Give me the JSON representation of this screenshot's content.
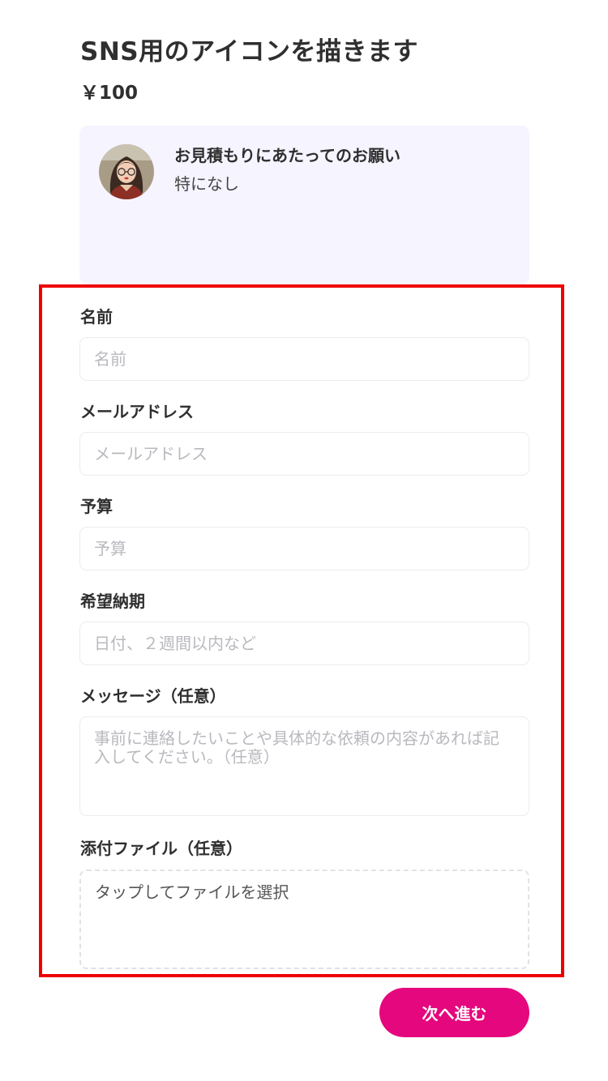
{
  "header": {
    "title": "SNS用のアイコンを描きます",
    "price": "￥100"
  },
  "request": {
    "title": "お見積もりにあたってのお願い",
    "body": "特になし",
    "avatar_icon": "seller-avatar"
  },
  "form": {
    "name": {
      "label": "名前",
      "placeholder": "名前",
      "value": ""
    },
    "email": {
      "label": "メールアドレス",
      "placeholder": "メールアドレス",
      "value": ""
    },
    "budget": {
      "label": "予算",
      "placeholder": "予算",
      "value": ""
    },
    "deadline": {
      "label": "希望納期",
      "placeholder": "日付、２週間以内など",
      "value": ""
    },
    "message": {
      "label": "メッセージ（任意）",
      "placeholder": "事前に連絡したいことや具体的な依頼の内容があれば記入してください。（任意）",
      "value": ""
    },
    "attachment": {
      "label": "添付ファイル（任意）",
      "prompt": "タップしてファイルを選択"
    }
  },
  "actions": {
    "next_label": "次へ進む"
  },
  "colors": {
    "accent": "#e5077d",
    "card_background": "#f6f4ff",
    "highlight_border": "#ee0000"
  }
}
